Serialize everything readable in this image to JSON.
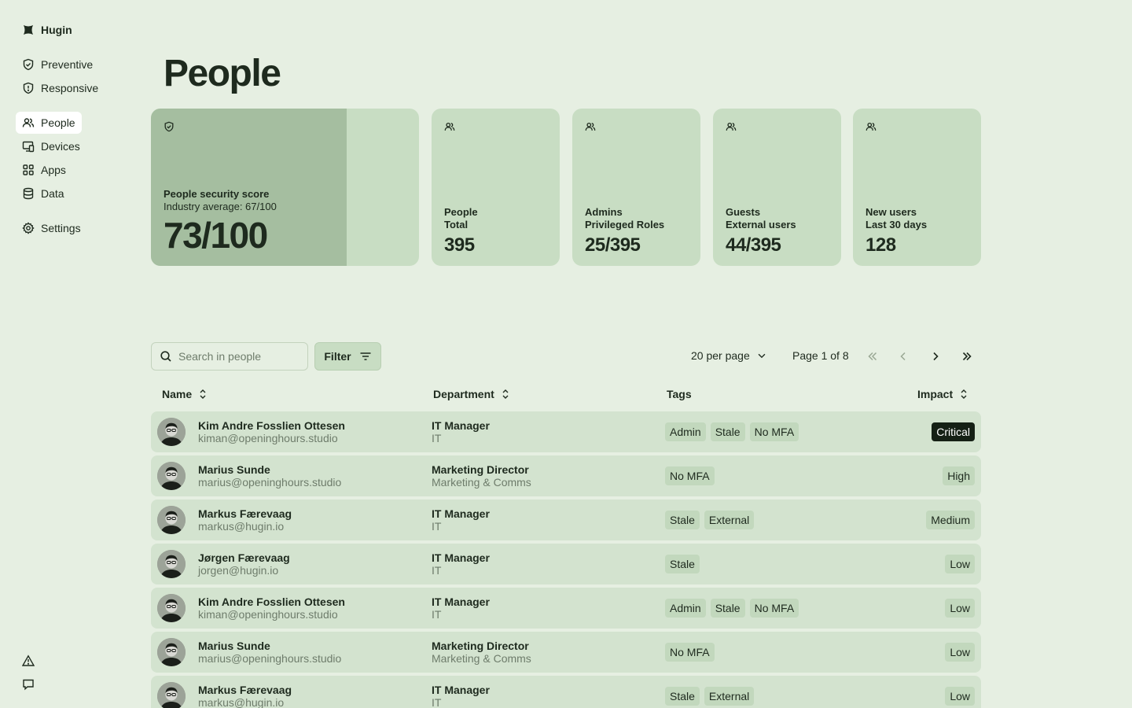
{
  "app": {
    "name": "Hugin"
  },
  "sidebar": {
    "items": [
      {
        "label": "Preventive",
        "icon": "shield-check-icon"
      },
      {
        "label": "Responsive",
        "icon": "shield-alert-icon"
      },
      {
        "label": "People",
        "icon": "users-icon",
        "active": true
      },
      {
        "label": "Devices",
        "icon": "devices-icon"
      },
      {
        "label": "Apps",
        "icon": "apps-grid-icon"
      },
      {
        "label": "Data",
        "icon": "database-icon"
      },
      {
        "label": "Settings",
        "icon": "gear-icon"
      }
    ],
    "bottom": [
      "warning-icon",
      "chat-icon"
    ]
  },
  "page": {
    "title": "People"
  },
  "cards": {
    "score": {
      "label": "People security score",
      "sublabel": "Industry average: 67/100",
      "value": "73/100",
      "fraction": 0.73
    },
    "people": {
      "label": "People",
      "sublabel": "Total",
      "value": "395"
    },
    "admins": {
      "label": "Admins",
      "sublabel": "Privileged Roles",
      "value": "25/395"
    },
    "guests": {
      "label": "Guests",
      "sublabel": "External users",
      "value": "44/395"
    },
    "new_users": {
      "label": "New users",
      "sublabel": "Last 30 days",
      "value": "128"
    }
  },
  "toolbar": {
    "search_placeholder": "Search in people",
    "filter_label": "Filter",
    "per_page": "20 per page",
    "page_info": "Page 1 of 8"
  },
  "table": {
    "headers": {
      "name": "Name",
      "department": "Department",
      "tags": "Tags",
      "impact": "Impact"
    },
    "rows": [
      {
        "name": "Kim Andre Fosslien Ottesen",
        "email": "kiman@openinghours.studio",
        "title": "IT Manager",
        "dept": "IT",
        "tags": [
          "Admin",
          "Stale",
          "No MFA"
        ],
        "impact": "Critical"
      },
      {
        "name": "Marius Sunde",
        "email": "marius@openinghours.studio",
        "title": "Marketing Director",
        "dept": "Marketing & Comms",
        "tags": [
          "No MFA"
        ],
        "impact": "High"
      },
      {
        "name": "Markus Færevaag",
        "email": "markus@hugin.io",
        "title": "IT Manager",
        "dept": "IT",
        "tags": [
          "Stale",
          "External"
        ],
        "impact": "Medium"
      },
      {
        "name": "Jørgen Færevaag",
        "email": "jorgen@hugin.io",
        "title": "IT Manager",
        "dept": "IT",
        "tags": [
          "Stale"
        ],
        "impact": "Low"
      },
      {
        "name": "Kim Andre Fosslien Ottesen",
        "email": "kiman@openinghours.studio",
        "title": "IT Manager",
        "dept": "IT",
        "tags": [
          "Admin",
          "Stale",
          "No MFA"
        ],
        "impact": "Low"
      },
      {
        "name": "Marius Sunde",
        "email": "marius@openinghours.studio",
        "title": "Marketing Director",
        "dept": "Marketing & Comms",
        "tags": [
          "No MFA"
        ],
        "impact": "Low"
      },
      {
        "name": "Markus Færevaag",
        "email": "markus@hugin.io",
        "title": "IT Manager",
        "dept": "IT",
        "tags": [
          "Stale",
          "External"
        ],
        "impact": "Low"
      }
    ]
  },
  "colors": {
    "background": "#e6efe2",
    "card": "#c8ddc3",
    "score_fill": "#a5bea0",
    "row": "#d3e3cf",
    "critical": "#152015"
  }
}
